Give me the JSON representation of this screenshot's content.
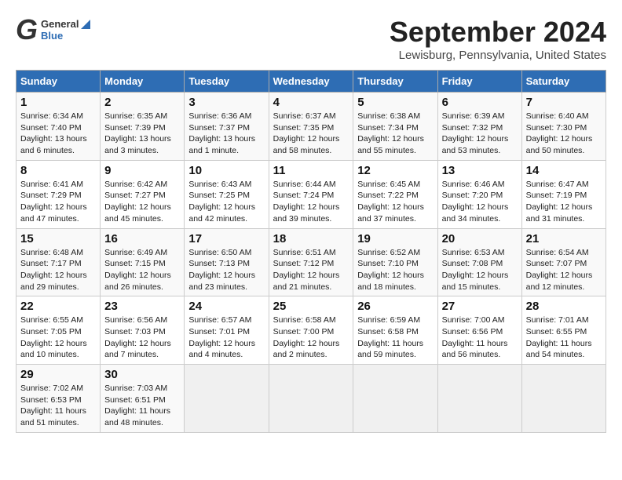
{
  "header": {
    "logo_general": "General",
    "logo_blue": "Blue",
    "month": "September 2024",
    "location": "Lewisburg, Pennsylvania, United States"
  },
  "days_of_week": [
    "Sunday",
    "Monday",
    "Tuesday",
    "Wednesday",
    "Thursday",
    "Friday",
    "Saturday"
  ],
  "weeks": [
    [
      {
        "day": "1",
        "info": "Sunrise: 6:34 AM\nSunset: 7:40 PM\nDaylight: 13 hours\nand 6 minutes."
      },
      {
        "day": "2",
        "info": "Sunrise: 6:35 AM\nSunset: 7:39 PM\nDaylight: 13 hours\nand 3 minutes."
      },
      {
        "day": "3",
        "info": "Sunrise: 6:36 AM\nSunset: 7:37 PM\nDaylight: 13 hours\nand 1 minute."
      },
      {
        "day": "4",
        "info": "Sunrise: 6:37 AM\nSunset: 7:35 PM\nDaylight: 12 hours\nand 58 minutes."
      },
      {
        "day": "5",
        "info": "Sunrise: 6:38 AM\nSunset: 7:34 PM\nDaylight: 12 hours\nand 55 minutes."
      },
      {
        "day": "6",
        "info": "Sunrise: 6:39 AM\nSunset: 7:32 PM\nDaylight: 12 hours\nand 53 minutes."
      },
      {
        "day": "7",
        "info": "Sunrise: 6:40 AM\nSunset: 7:30 PM\nDaylight: 12 hours\nand 50 minutes."
      }
    ],
    [
      {
        "day": "8",
        "info": "Sunrise: 6:41 AM\nSunset: 7:29 PM\nDaylight: 12 hours\nand 47 minutes."
      },
      {
        "day": "9",
        "info": "Sunrise: 6:42 AM\nSunset: 7:27 PM\nDaylight: 12 hours\nand 45 minutes."
      },
      {
        "day": "10",
        "info": "Sunrise: 6:43 AM\nSunset: 7:25 PM\nDaylight: 12 hours\nand 42 minutes."
      },
      {
        "day": "11",
        "info": "Sunrise: 6:44 AM\nSunset: 7:24 PM\nDaylight: 12 hours\nand 39 minutes."
      },
      {
        "day": "12",
        "info": "Sunrise: 6:45 AM\nSunset: 7:22 PM\nDaylight: 12 hours\nand 37 minutes."
      },
      {
        "day": "13",
        "info": "Sunrise: 6:46 AM\nSunset: 7:20 PM\nDaylight: 12 hours\nand 34 minutes."
      },
      {
        "day": "14",
        "info": "Sunrise: 6:47 AM\nSunset: 7:19 PM\nDaylight: 12 hours\nand 31 minutes."
      }
    ],
    [
      {
        "day": "15",
        "info": "Sunrise: 6:48 AM\nSunset: 7:17 PM\nDaylight: 12 hours\nand 29 minutes."
      },
      {
        "day": "16",
        "info": "Sunrise: 6:49 AM\nSunset: 7:15 PM\nDaylight: 12 hours\nand 26 minutes."
      },
      {
        "day": "17",
        "info": "Sunrise: 6:50 AM\nSunset: 7:13 PM\nDaylight: 12 hours\nand 23 minutes."
      },
      {
        "day": "18",
        "info": "Sunrise: 6:51 AM\nSunset: 7:12 PM\nDaylight: 12 hours\nand 21 minutes."
      },
      {
        "day": "19",
        "info": "Sunrise: 6:52 AM\nSunset: 7:10 PM\nDaylight: 12 hours\nand 18 minutes."
      },
      {
        "day": "20",
        "info": "Sunrise: 6:53 AM\nSunset: 7:08 PM\nDaylight: 12 hours\nand 15 minutes."
      },
      {
        "day": "21",
        "info": "Sunrise: 6:54 AM\nSunset: 7:07 PM\nDaylight: 12 hours\nand 12 minutes."
      }
    ],
    [
      {
        "day": "22",
        "info": "Sunrise: 6:55 AM\nSunset: 7:05 PM\nDaylight: 12 hours\nand 10 minutes."
      },
      {
        "day": "23",
        "info": "Sunrise: 6:56 AM\nSunset: 7:03 PM\nDaylight: 12 hours\nand 7 minutes."
      },
      {
        "day": "24",
        "info": "Sunrise: 6:57 AM\nSunset: 7:01 PM\nDaylight: 12 hours\nand 4 minutes."
      },
      {
        "day": "25",
        "info": "Sunrise: 6:58 AM\nSunset: 7:00 PM\nDaylight: 12 hours\nand 2 minutes."
      },
      {
        "day": "26",
        "info": "Sunrise: 6:59 AM\nSunset: 6:58 PM\nDaylight: 11 hours\nand 59 minutes."
      },
      {
        "day": "27",
        "info": "Sunrise: 7:00 AM\nSunset: 6:56 PM\nDaylight: 11 hours\nand 56 minutes."
      },
      {
        "day": "28",
        "info": "Sunrise: 7:01 AM\nSunset: 6:55 PM\nDaylight: 11 hours\nand 54 minutes."
      }
    ],
    [
      {
        "day": "29",
        "info": "Sunrise: 7:02 AM\nSunset: 6:53 PM\nDaylight: 11 hours\nand 51 minutes."
      },
      {
        "day": "30",
        "info": "Sunrise: 7:03 AM\nSunset: 6:51 PM\nDaylight: 11 hours\nand 48 minutes."
      },
      null,
      null,
      null,
      null,
      null
    ]
  ]
}
